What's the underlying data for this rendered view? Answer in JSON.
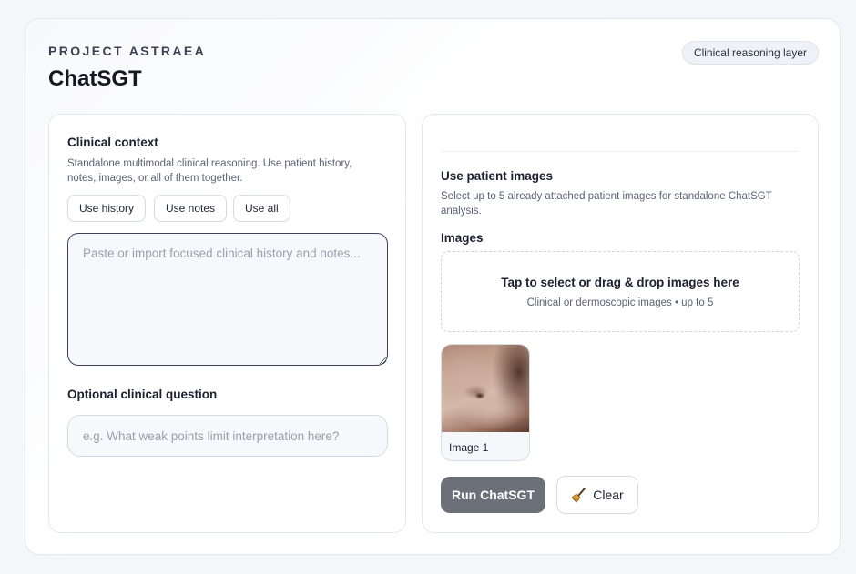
{
  "header": {
    "eyebrow": "PROJECT ASTRAEA",
    "title": "ChatSGT",
    "badge": "Clinical reasoning layer"
  },
  "context": {
    "heading": "Clinical context",
    "description": "Standalone multimodal clinical reasoning. Use patient history, notes, images, or all of them together.",
    "chips": [
      "Use history",
      "Use notes",
      "Use all"
    ],
    "history_placeholder": "Paste or import focused clinical history and notes...",
    "question_heading": "Optional clinical question",
    "question_placeholder": "e.g. What weak points limit interpretation here?"
  },
  "images": {
    "heading": "Use patient images",
    "description": "Select up to 5 already attached patient images for standalone ChatSGT analysis.",
    "section_label": "Images",
    "drop_main": "Tap to select or drag & drop images here",
    "drop_sub": "Clinical or dermoscopic images • up to 5",
    "thumbnails": [
      {
        "label": "Image 1"
      }
    ]
  },
  "actions": {
    "run_label": "Run ChatSGT",
    "clear_label": "Clear",
    "clear_icon": "broom-icon"
  },
  "colors": {
    "run_button": "#6c7078",
    "accent_border": "#3b4458"
  }
}
